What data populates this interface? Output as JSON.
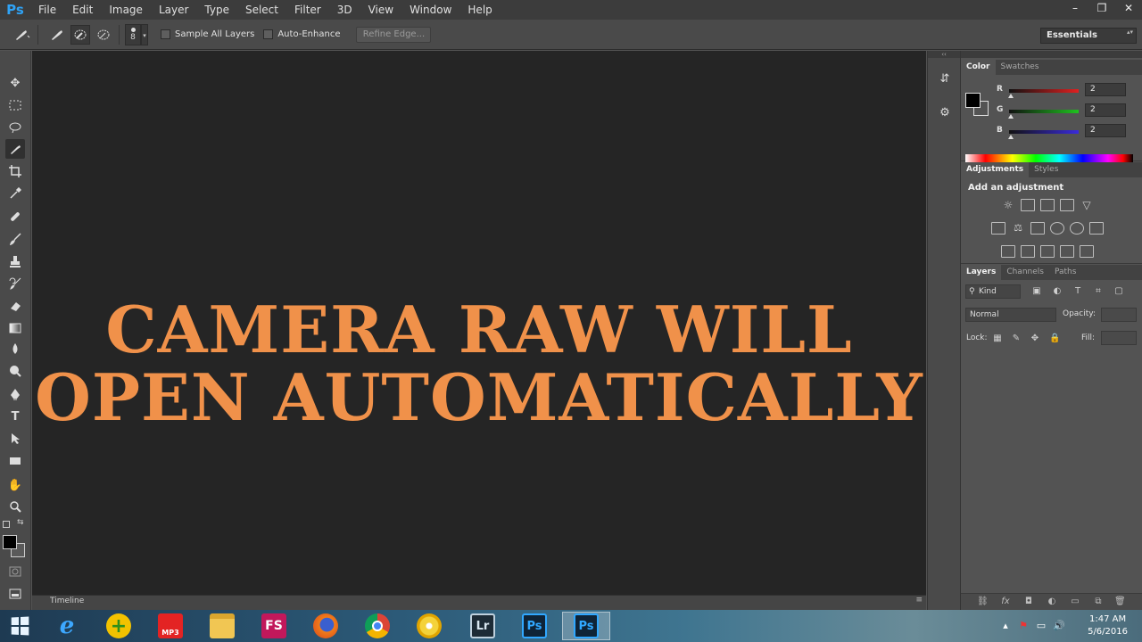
{
  "app": {
    "logo": "Ps"
  },
  "menu": [
    "File",
    "Edit",
    "Image",
    "Layer",
    "Type",
    "Select",
    "Filter",
    "3D",
    "View",
    "Window",
    "Help"
  ],
  "window_controls": {
    "minimize": "–",
    "restore": "❐",
    "close": "✕"
  },
  "options_bar": {
    "brush_size": "8",
    "sample_all_layers": "Sample All Layers",
    "auto_enhance": "Auto-Enhance",
    "refine_edge": "Refine Edge...",
    "workspace": "Essentials"
  },
  "overlay_text": {
    "line1": "CAMERA RAW WILL",
    "line2": "OPEN AUTOMATICALLY",
    "color": "#f0914a"
  },
  "timeline": {
    "label": "Timeline"
  },
  "color_panel": {
    "tabs": [
      "Color",
      "Swatches"
    ],
    "r_label": "R",
    "g_label": "G",
    "b_label": "B",
    "r_value": "2",
    "g_value": "2",
    "b_value": "2",
    "r_color": "#e02020",
    "g_color": "#1fc21f",
    "b_color": "#3a2bdc"
  },
  "adjustments_panel": {
    "tabs": [
      "Adjustments",
      "Styles"
    ],
    "title": "Add an adjustment"
  },
  "layers_panel": {
    "tabs": [
      "Layers",
      "Channels",
      "Paths"
    ],
    "kind": "Kind",
    "blend_mode": "Normal",
    "opacity_label": "Opacity:",
    "lock_label": "Lock:",
    "fill_label": "Fill:"
  },
  "taskbar": {
    "apps": [
      "internet-explorer",
      "add",
      "youtube-mp3",
      "file-explorer",
      "FS",
      "firefox",
      "chrome",
      "media-disc",
      "Lr",
      "Ps",
      "Ps"
    ],
    "fs_label": "FS",
    "mp3_label": "MP3",
    "lr_label": "Lr",
    "ps_label": "Ps",
    "clock_time": "1:47 AM",
    "clock_date": "5/6/2016"
  }
}
